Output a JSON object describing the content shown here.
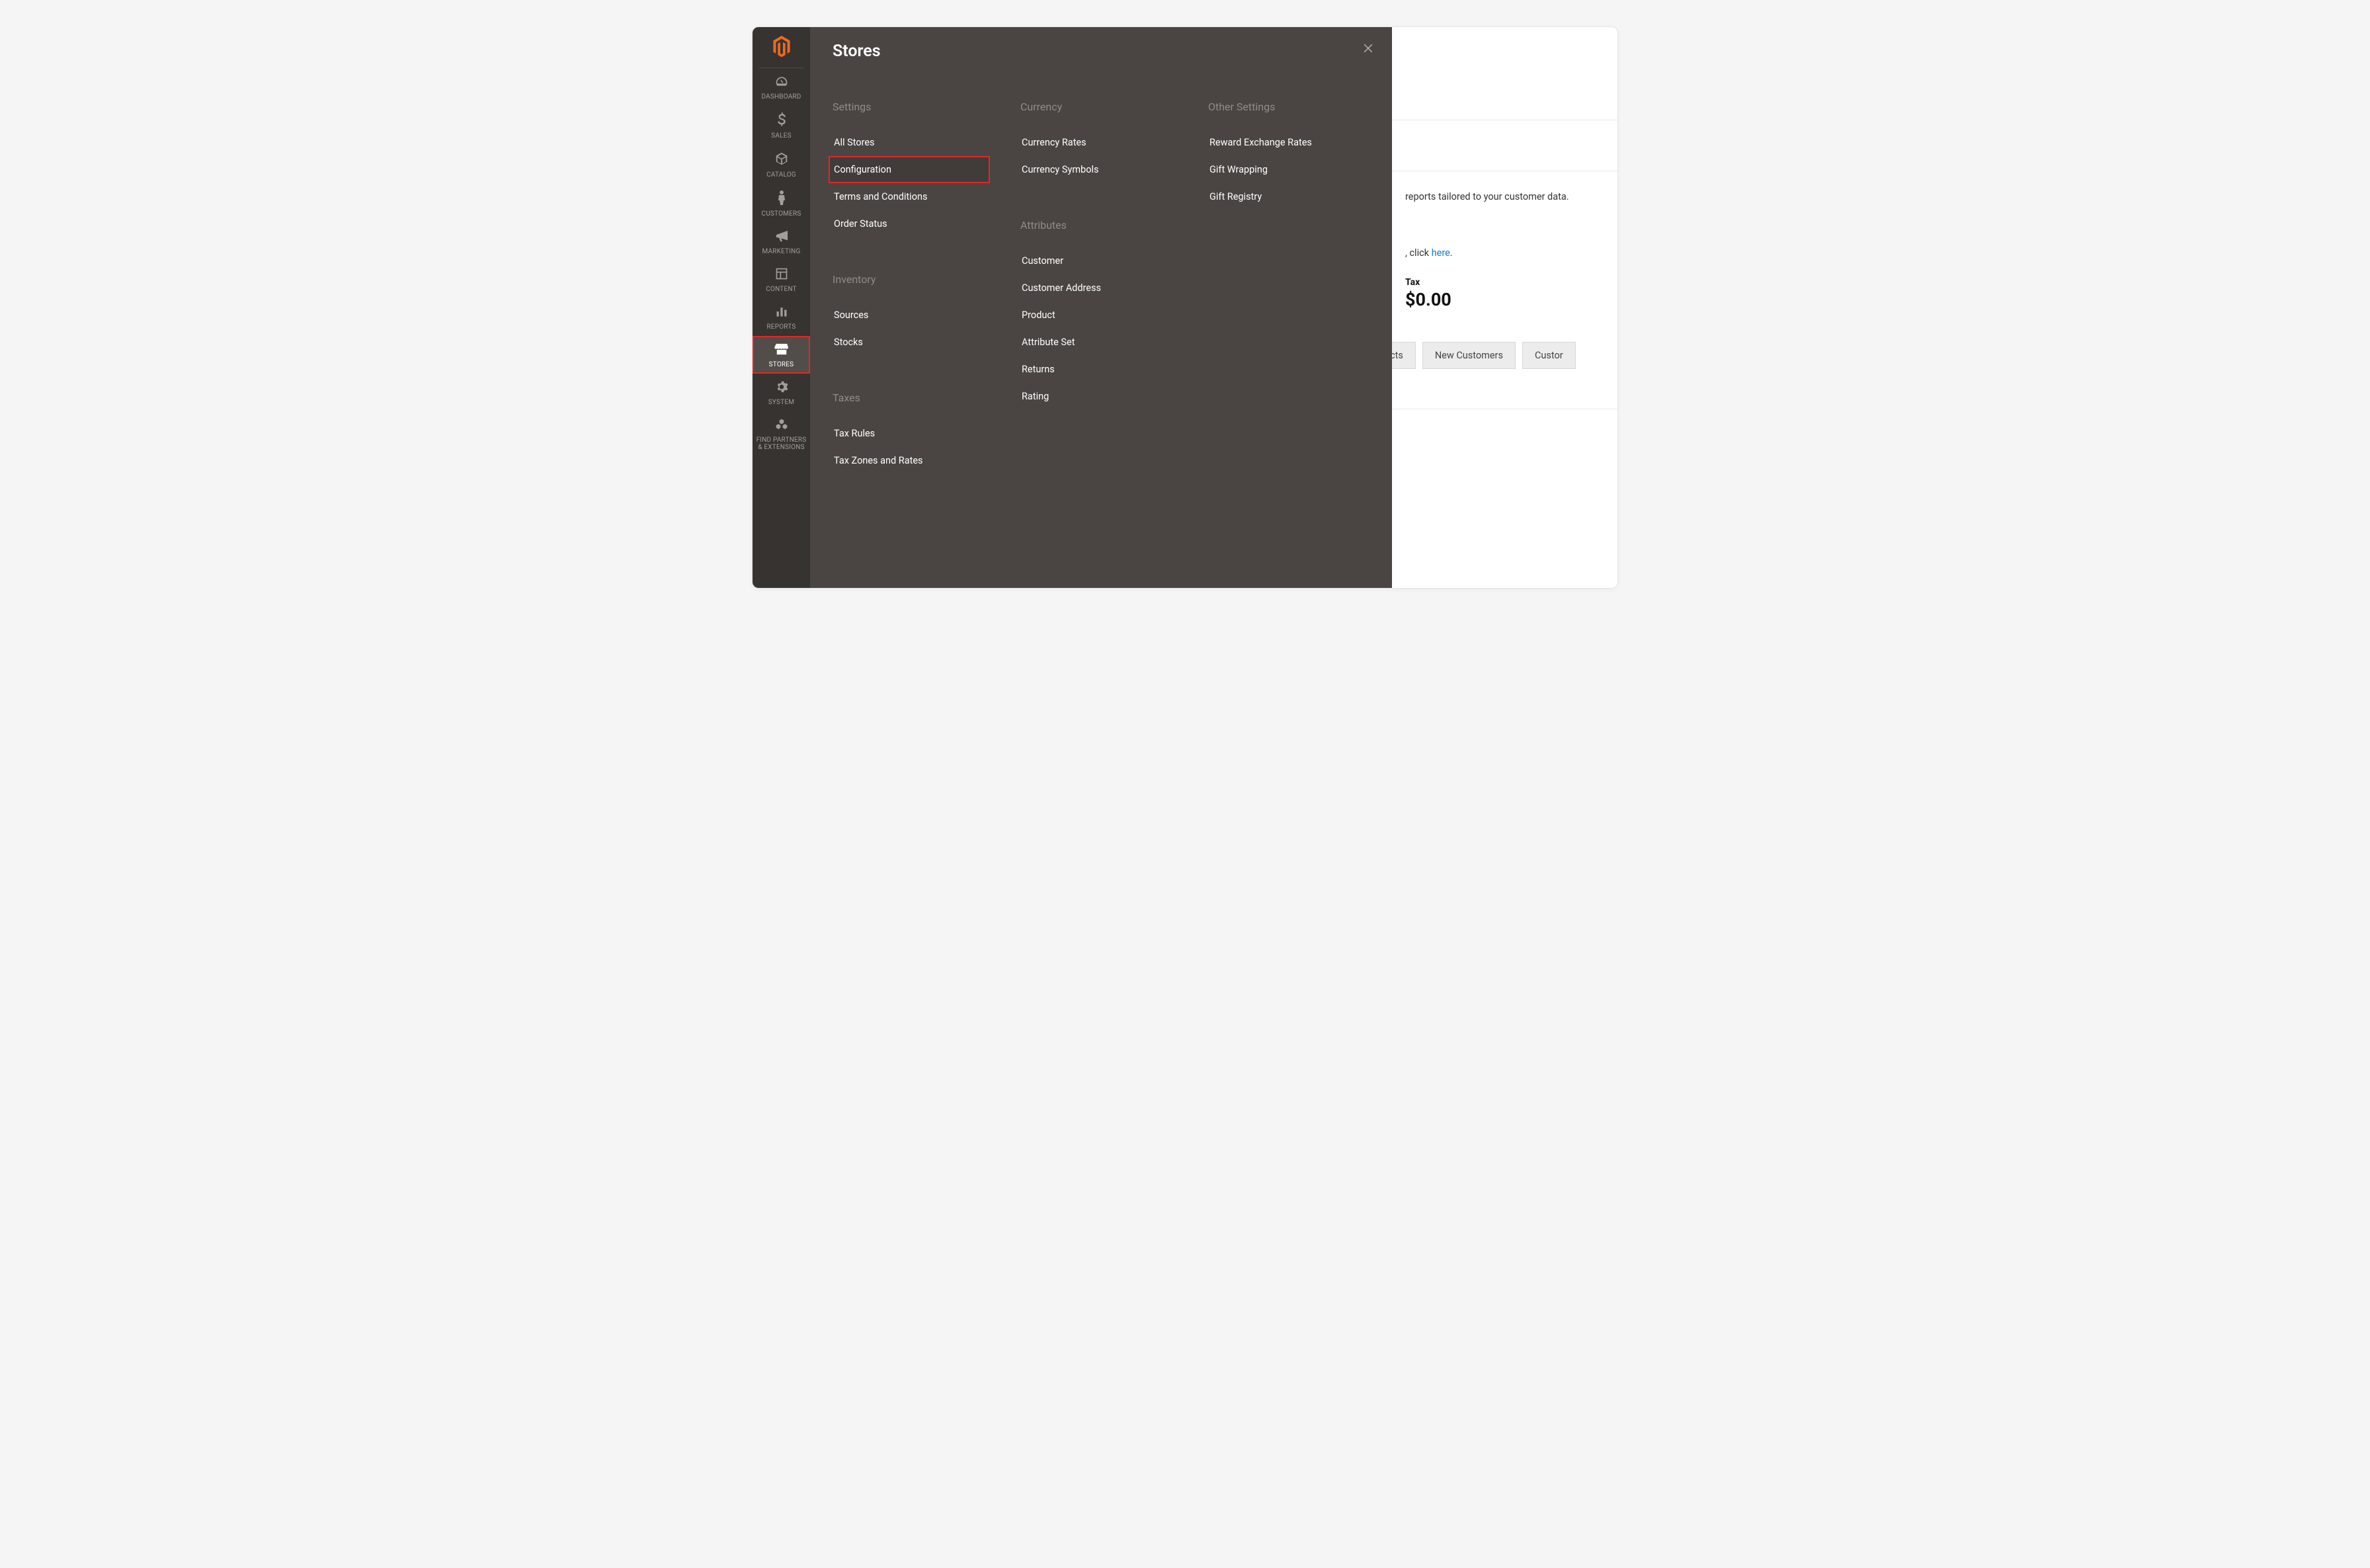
{
  "sidebar": {
    "items": [
      {
        "label": "DASHBOARD"
      },
      {
        "label": "SALES"
      },
      {
        "label": "CATALOG"
      },
      {
        "label": "CUSTOMERS"
      },
      {
        "label": "MARKETING"
      },
      {
        "label": "CONTENT"
      },
      {
        "label": "REPORTS"
      },
      {
        "label": "STORES"
      },
      {
        "label": "SYSTEM"
      },
      {
        "label": "FIND PARTNERS & EXTENSIONS"
      }
    ]
  },
  "flyout": {
    "title": "Stores",
    "columns": [
      {
        "groups": [
          {
            "title": "Settings",
            "items": [
              "All Stores",
              "Configuration",
              "Terms and Conditions",
              "Order Status"
            ]
          },
          {
            "title": "Inventory",
            "items": [
              "Sources",
              "Stocks"
            ]
          },
          {
            "title": "Taxes",
            "items": [
              "Tax Rules",
              "Tax Zones and Rates"
            ]
          }
        ]
      },
      {
        "groups": [
          {
            "title": "Currency",
            "items": [
              "Currency Rates",
              "Currency Symbols"
            ]
          },
          {
            "title": "Attributes",
            "items": [
              "Customer",
              "Customer Address",
              "Product",
              "Attribute Set",
              "Returns",
              "Rating"
            ]
          }
        ]
      },
      {
        "groups": [
          {
            "title": "Other Settings",
            "items": [
              "Reward Exchange Rates",
              "Gift Wrapping",
              "Gift Registry"
            ]
          }
        ]
      }
    ]
  },
  "background": {
    "text_fragment_1": "reports tailored to your customer data.",
    "text_fragment_2": ", click ",
    "link_text": "here",
    "period": ".",
    "stat_label": "Tax",
    "stat_value": "$0.00",
    "tabs": [
      "ucts",
      "New Customers",
      "Custor"
    ]
  }
}
